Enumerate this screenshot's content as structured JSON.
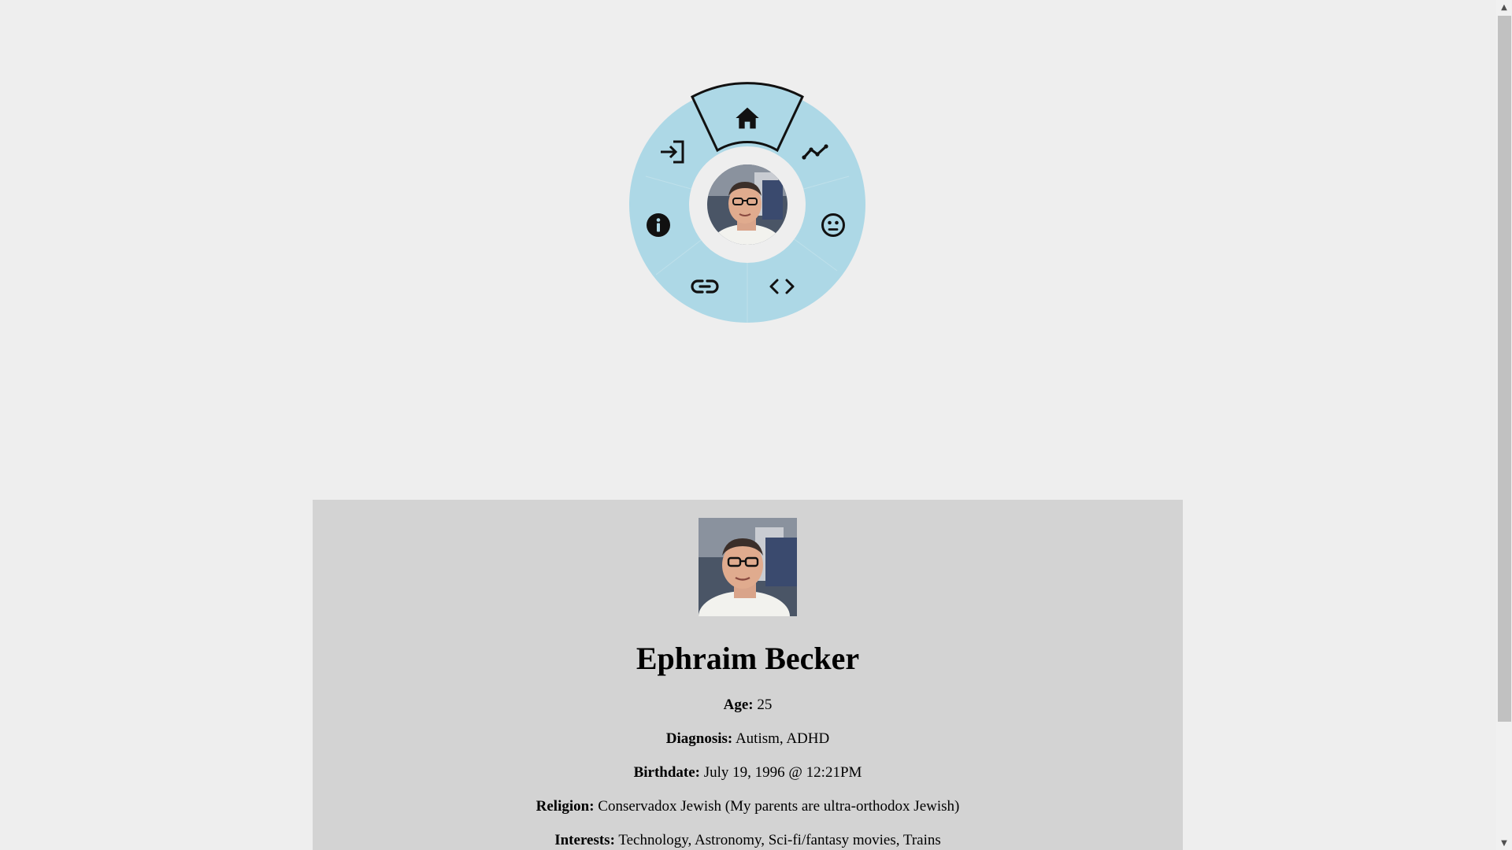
{
  "radial_menu": {
    "colors": {
      "ring": "#add8e6",
      "hub": "#eeeeee",
      "active_outline": "#111111"
    },
    "items": [
      {
        "id": "home",
        "icon": "home-icon",
        "active": true
      },
      {
        "id": "stats",
        "icon": "trending-icon",
        "active": false
      },
      {
        "id": "mood",
        "icon": "neutral-face-icon",
        "active": false
      },
      {
        "id": "code",
        "icon": "code-brackets-icon",
        "active": false
      },
      {
        "id": "links",
        "icon": "link-icon",
        "active": false
      },
      {
        "id": "info",
        "icon": "info-icon",
        "active": false
      },
      {
        "id": "login",
        "icon": "login-icon",
        "active": false
      }
    ]
  },
  "profile": {
    "name": "Ephraim Becker",
    "fields": [
      {
        "label": "Age:",
        "value": "25"
      },
      {
        "label": "Diagnosis:",
        "value": "Autism, ADHD"
      },
      {
        "label": "Birthdate:",
        "value": "July 19, 1996 @ 12:21PM"
      },
      {
        "label": "Religion:",
        "value": "Conservadox Jewish (My parents are ultra-orthodox Jewish)"
      },
      {
        "label": "Interests:",
        "value": "Technology, Astronomy, Sci-fi/fantasy movies, Trains"
      }
    ]
  },
  "colors": {
    "page_bg": "#eeeeee",
    "card_bg": "#d3d3d3"
  }
}
